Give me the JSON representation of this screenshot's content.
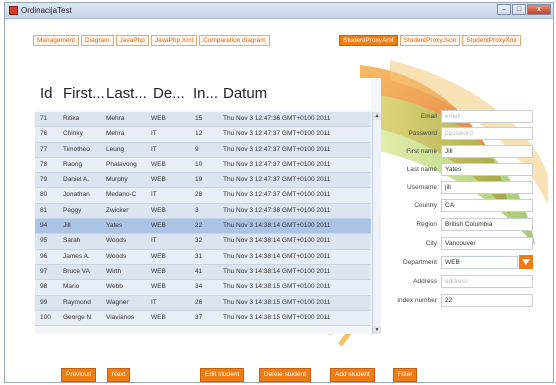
{
  "window": {
    "title": "OrdinacijaTest",
    "minimize": "–",
    "maximize": "□",
    "close": "x"
  },
  "tabs_left": [
    "Management",
    "Diagram",
    "JavaPhp",
    "JavaPhp Xml",
    "Comparation diagram"
  ],
  "tabs_right": [
    "StudentProxyAmf",
    "StudentProxyJson",
    "StudentProxyXml"
  ],
  "grid": {
    "headers": [
      "Id",
      "First...",
      "Last...",
      "De...",
      "In...",
      "Datum"
    ],
    "rows": [
      [
        "71",
        "Ritika",
        "Mehra",
        "WEB",
        "15",
        "Thu Nov 3 12:47:36 GMT+0100 2011"
      ],
      [
        "76",
        "Chinky",
        "Mehra",
        "IT",
        "12",
        "Thu Nov 3 12:47:37 GMT+0100 2011"
      ],
      [
        "77",
        "Timotheo",
        "Leung",
        "IT",
        "9",
        "Thu Nov 3 12:47:37 GMT+0100 2011"
      ],
      [
        "78",
        "Raong",
        "Phalavong",
        "WEB",
        "10",
        "Thu Nov 3 12:47:37 GMT+0100 2011"
      ],
      [
        "79",
        "Daniel A.",
        "Murphy",
        "WEB",
        "19",
        "Thu Nov 3 12:47:37 GMT+0100 2011"
      ],
      [
        "80",
        "Jonathan",
        "Medano-C",
        "IT",
        "28",
        "Thu Nov 3 12:47:37 GMT+0100 2011"
      ],
      [
        "81",
        "Peggy",
        "Zwicker",
        "WEB",
        "3",
        "Thu Nov 3 12:47:38 GMT+0100 2011"
      ],
      [
        "94",
        "Jill",
        "Yates",
        "WEB",
        "22",
        "Thu Nov 3 14:38:14 GMT+0100 2011"
      ],
      [
        "95",
        "Sarah",
        "Woods",
        "IT",
        "32",
        "Thu Nov 3 14:38:14 GMT+0100 2011"
      ],
      [
        "96",
        "James A.",
        "Woods",
        "WEB",
        "31",
        "Thu Nov 3 14:38:14 GMT+0100 2011"
      ],
      [
        "97",
        "Bruce VA",
        "Wirth",
        "WEB",
        "41",
        "Thu Nov 3 14:38:14 GMT+0100 2011"
      ],
      [
        "98",
        "Mario",
        "Webb",
        "WEB",
        "34",
        "Thu Nov 3 14:38:15 GMT+0100 2011"
      ],
      [
        "99",
        "Raymond",
        "Wagner",
        "IT",
        "26",
        "Thu Nov 3 14:38:15 GMT+0100 2011"
      ],
      [
        "100",
        "George N",
        "Viavianos",
        "WEB",
        "37",
        "Thu Nov 3 14:38:15 GMT+0100 2011"
      ]
    ],
    "selected_index": 7,
    "scroll_up": "▲",
    "scroll_down": "▼"
  },
  "form": {
    "email": {
      "label": "Email",
      "placeholder": "email"
    },
    "password": {
      "label": "Password",
      "placeholder": "password"
    },
    "first_name": {
      "label": "First name",
      "value": "Jill"
    },
    "last_name": {
      "label": "Last name",
      "value": "Yates"
    },
    "username": {
      "label": "Username",
      "value": "jill"
    },
    "country": {
      "label": "Country",
      "value": "CA"
    },
    "region": {
      "label": "Region",
      "value": "British Columbia"
    },
    "city": {
      "label": "City",
      "value": "Vancouver"
    },
    "department": {
      "label": "Department",
      "value": "WEB"
    },
    "address": {
      "label": "Address",
      "placeholder": "address"
    },
    "index_number": {
      "label": "Index number",
      "value": "22"
    }
  },
  "buttons": {
    "previous": "Previous",
    "next": "Next",
    "edit": "Edit student",
    "delete": "Delete student",
    "add": "Add student",
    "filter": "Filter"
  },
  "colors": {
    "accent": "#f07d13",
    "selected_row": "#a9c4e6",
    "row": "#dbe5f1",
    "titlebar": "#c5d6e9"
  }
}
